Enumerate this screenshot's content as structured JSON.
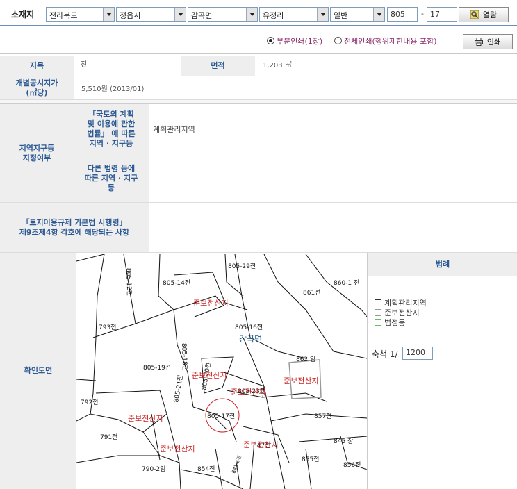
{
  "search": {
    "label": "소재지",
    "province": "전라북도",
    "city": "정읍시",
    "district": "감곡면",
    "village": "유정리",
    "land_type": "일반",
    "main_number": "805",
    "sub_number": "17",
    "view_button": "열람"
  },
  "print": {
    "option_partial": "부분인쇄(1장)",
    "option_full": "전체인쇄(행위제한내용 포함)",
    "print_button": "인쇄"
  },
  "info": {
    "jimok_label": "지목",
    "jimok_value": "전",
    "area_label": "면적",
    "area_value": "1,203 ㎡",
    "price_label": "개별공시지가\n(㎡당)",
    "price_value": "5,510원 (2013/01)",
    "zone_label": "지역지구등\n지정여부",
    "zone_sub1_label": "「국토의 계획\n및 이용에 관한\n법률」 에 따른\n지역 · 지구등",
    "zone_sub1_value": "계획관리지역",
    "zone_sub2_label": "다른 법령 등에\n따른 지역 · 지구\n등",
    "zone_sub2_value": "",
    "reg_label": "「토지이용규제 기본법 시행령」\n제9조제4항 각호에 해당되는 사항",
    "reg_value": "",
    "map_label": "확인도면"
  },
  "legend": {
    "title": "범례",
    "items": [
      {
        "label": "계획관리지역",
        "color": "#333333"
      },
      {
        "label": "준보전산지",
        "color": "#999999"
      },
      {
        "label": "법정동",
        "color": "#66bb66"
      }
    ],
    "scale_label": "축척 1/",
    "scale_value": "1200"
  },
  "map": {
    "labels": [
      "805-29전",
      "805-12전",
      "805-14전",
      "861전",
      "860-1 전",
      "793전",
      "805-16전",
      "805-18전",
      "805-19전",
      "862 임",
      "792전",
      "805-17전",
      "857전",
      "791전",
      "845 장",
      "855전",
      "856전",
      "790-2임",
      "854전",
      "805-21전",
      "805-20전",
      "805-23전",
      "847전",
      "841-6전"
    ],
    "area_label": "감곡면",
    "zone_labels": [
      "준보전산지",
      "준보전산지",
      "준보전산지",
      "준보전산지",
      "준보전산지",
      "준보전산지",
      "준보전산지"
    ]
  },
  "colors": {
    "header_text": "#2d5a94",
    "header_bg": "#eeeeee",
    "zone_text": "#cc2222",
    "area_text": "#1a5c8a"
  }
}
